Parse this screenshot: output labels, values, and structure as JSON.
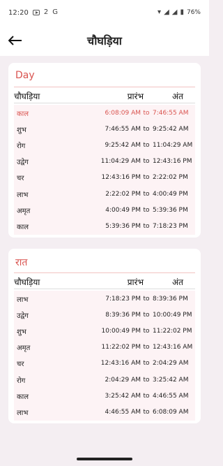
{
  "status_bar": {
    "time": "12:20",
    "notif_text": "2",
    "notif_letter": "G",
    "battery": "76%"
  },
  "app_bar": {
    "title": "चौघड़िया"
  },
  "day": {
    "title": "Day",
    "headers": {
      "name": "चौघड़िया",
      "start": "प्रारंभ",
      "end": "अंत"
    },
    "rows": [
      {
        "name": "काल",
        "start": "6:08:09 AM",
        "to": "to",
        "end": "7:46:55 AM"
      },
      {
        "name": "शुभ",
        "start": "7:46:55 AM",
        "to": "to",
        "end": "9:25:42 AM"
      },
      {
        "name": "रोग",
        "start": "9:25:42 AM",
        "to": "to",
        "end": "11:04:29 AM"
      },
      {
        "name": "उद्वेग",
        "start": "11:04:29 AM",
        "to": "to",
        "end": "12:43:16 PM"
      },
      {
        "name": "चर",
        "start": "12:43:16 PM",
        "to": "to",
        "end": "2:22:02 PM"
      },
      {
        "name": "लाभ",
        "start": "2:22:02 PM",
        "to": "to",
        "end": "4:00:49 PM"
      },
      {
        "name": "अमृत",
        "start": "4:00:49 PM",
        "to": "to",
        "end": "5:39:36 PM"
      },
      {
        "name": "काल",
        "start": "5:39:36 PM",
        "to": "to",
        "end": "7:18:23 PM"
      }
    ]
  },
  "night": {
    "title": "रात",
    "headers": {
      "name": "चौघड़िया",
      "start": "प्रारंभ",
      "end": "अंत"
    },
    "rows": [
      {
        "name": "लाभ",
        "start": "7:18:23 PM",
        "to": "to",
        "end": "8:39:36 PM"
      },
      {
        "name": "उद्वेग",
        "start": "8:39:36 PM",
        "to": "to",
        "end": "10:00:49 PM"
      },
      {
        "name": "शुभ",
        "start": "10:00:49 PM",
        "to": "to",
        "end": "11:22:02 PM"
      },
      {
        "name": "अमृत",
        "start": "11:22:02 PM",
        "to": "to",
        "end": "12:43:16 AM"
      },
      {
        "name": "चर",
        "start": "12:43:16 AM",
        "to": "to",
        "end": "2:04:29 AM"
      },
      {
        "name": "रोग",
        "start": "2:04:29 AM",
        "to": "to",
        "end": "3:25:42 AM"
      },
      {
        "name": "काल",
        "start": "3:25:42 AM",
        "to": "to",
        "end": "4:46:55 AM"
      },
      {
        "name": "लाभ",
        "start": "4:46:55 AM",
        "to": "to",
        "end": "6:08:09 AM"
      }
    ]
  },
  "colors": {
    "accent": "#d9534f",
    "row_bg": "#fdf3f5",
    "page_bg": "#f4eef2"
  }
}
